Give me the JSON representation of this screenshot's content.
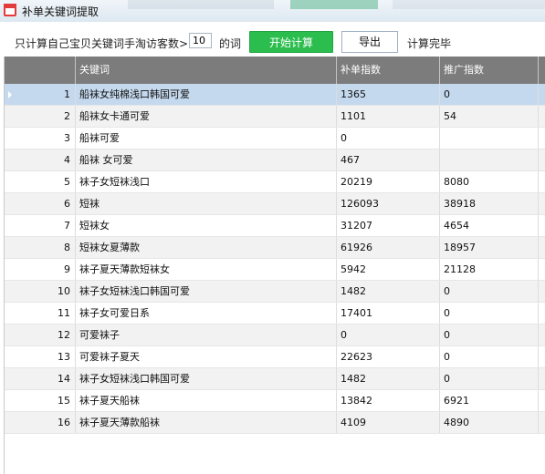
{
  "window": {
    "title": "补单关键词提取"
  },
  "toolbar": {
    "label": "只计算自己宝贝关键词手淘访客数>=",
    "input_value": "10",
    "suffix": "的词",
    "start_button": "开始计算",
    "export_button": "导出",
    "status": "计算完毕"
  },
  "table": {
    "headers": [
      "",
      "关键词",
      "补单指数",
      "推广指数"
    ],
    "rows": [
      {
        "index": "1",
        "keyword": "船袜女纯棉浅口韩国可爱",
        "budan": "1365",
        "promo": "0"
      },
      {
        "index": "2",
        "keyword": "船袜女卡通可爱",
        "budan": "1101",
        "promo": "54"
      },
      {
        "index": "3",
        "keyword": "船袜可爱",
        "budan": "0",
        "promo": ""
      },
      {
        "index": "4",
        "keyword": "船袜 女可爱",
        "budan": "467",
        "promo": ""
      },
      {
        "index": "5",
        "keyword": "袜子女短袜浅口",
        "budan": "20219",
        "promo": "8080"
      },
      {
        "index": "6",
        "keyword": "短袜",
        "budan": "126093",
        "promo": "38918"
      },
      {
        "index": "7",
        "keyword": "短袜女",
        "budan": "31207",
        "promo": "4654"
      },
      {
        "index": "8",
        "keyword": "短袜女夏薄款",
        "budan": "61926",
        "promo": "18957"
      },
      {
        "index": "9",
        "keyword": "袜子夏天薄款短袜女",
        "budan": "5942",
        "promo": "21128"
      },
      {
        "index": "10",
        "keyword": "袜子女短袜浅口韩国可爱",
        "budan": "1482",
        "promo": "0"
      },
      {
        "index": "11",
        "keyword": "袜子女可爱日系",
        "budan": "17401",
        "promo": "0"
      },
      {
        "index": "12",
        "keyword": "可爱袜子",
        "budan": "0",
        "promo": "0"
      },
      {
        "index": "13",
        "keyword": "可爱袜子夏天",
        "budan": "22623",
        "promo": "0"
      },
      {
        "index": "14",
        "keyword": "袜子女短袜浅口韩国可爱",
        "budan": "1482",
        "promo": "0"
      },
      {
        "index": "15",
        "keyword": "袜子夏天船袜",
        "budan": "13842",
        "promo": "6921"
      },
      {
        "index": "16",
        "keyword": "袜子夏天薄款船袜",
        "budan": "4109",
        "promo": "4890"
      }
    ]
  },
  "colors": {
    "accent_green": "#2bbd4d",
    "selected_row": "#c5d9ee",
    "header_bg": "#7c7c7c"
  }
}
